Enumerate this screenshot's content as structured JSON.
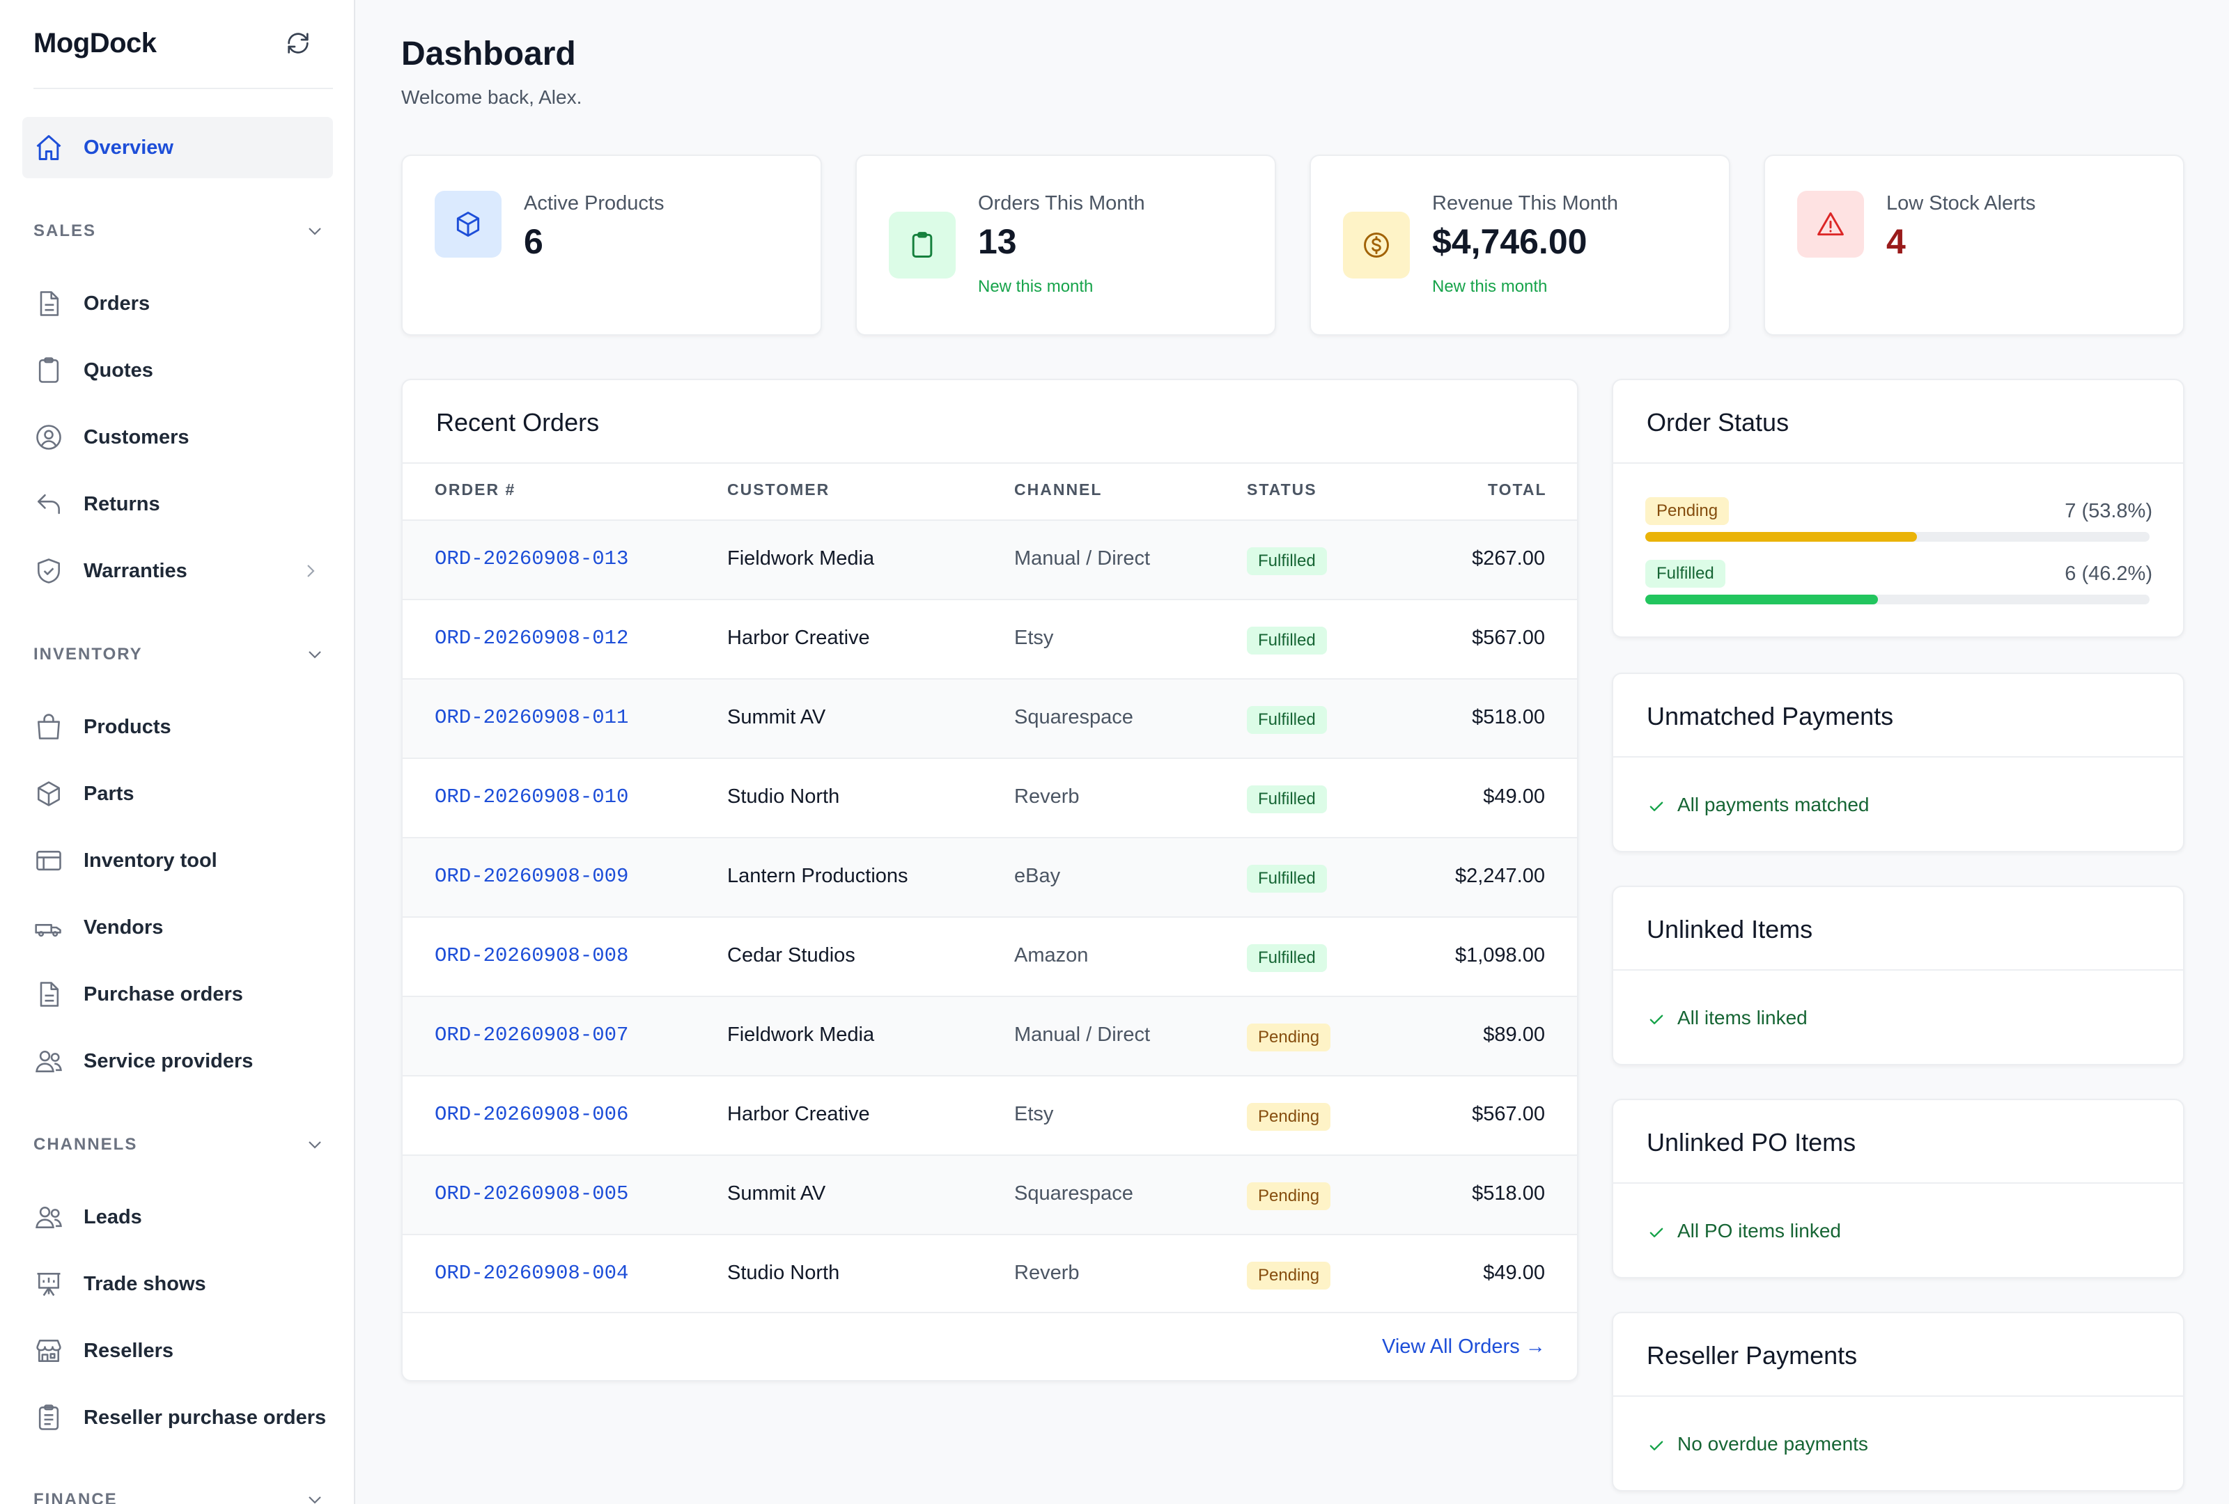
{
  "app": {
    "name": "MogDock"
  },
  "sidebar": {
    "overview": "Overview",
    "sections": {
      "sales": "SALES",
      "inventory": "INVENTORY",
      "channels": "CHANNELS",
      "finance": "FINANCE"
    },
    "sales_items": [
      "Orders",
      "Quotes",
      "Customers",
      "Returns",
      "Warranties"
    ],
    "inventory_items": [
      "Products",
      "Parts",
      "Inventory tool",
      "Vendors",
      "Purchase orders",
      "Service providers"
    ],
    "channels_items": [
      "Leads",
      "Trade shows",
      "Resellers",
      "Reseller purchase orders"
    ]
  },
  "header": {
    "title": "Dashboard",
    "subtitle": "Welcome back, Alex."
  },
  "stats": [
    {
      "label": "Active Products",
      "value": "6",
      "note": ""
    },
    {
      "label": "Orders This Month",
      "value": "13",
      "note": "New this month"
    },
    {
      "label": "Revenue This Month",
      "value": "$4,746.00",
      "note": "New this month"
    },
    {
      "label": "Low Stock Alerts",
      "value": "4",
      "note": ""
    }
  ],
  "recent_orders": {
    "title": "Recent Orders",
    "columns": [
      "ORDER #",
      "CUSTOMER",
      "CHANNEL",
      "STATUS",
      "TOTAL"
    ],
    "rows": [
      {
        "id": "ORD-20260908-013",
        "customer": "Fieldwork Media",
        "channel": "Manual / Direct",
        "status": "Fulfilled",
        "total": "$267.00"
      },
      {
        "id": "ORD-20260908-012",
        "customer": "Harbor Creative",
        "channel": "Etsy",
        "status": "Fulfilled",
        "total": "$567.00"
      },
      {
        "id": "ORD-20260908-011",
        "customer": "Summit AV",
        "channel": "Squarespace",
        "status": "Fulfilled",
        "total": "$518.00"
      },
      {
        "id": "ORD-20260908-010",
        "customer": "Studio North",
        "channel": "Reverb",
        "status": "Fulfilled",
        "total": "$49.00"
      },
      {
        "id": "ORD-20260908-009",
        "customer": "Lantern Productions",
        "channel": "eBay",
        "status": "Fulfilled",
        "total": "$2,247.00"
      },
      {
        "id": "ORD-20260908-008",
        "customer": "Cedar Studios",
        "channel": "Amazon",
        "status": "Fulfilled",
        "total": "$1,098.00"
      },
      {
        "id": "ORD-20260908-007",
        "customer": "Fieldwork Media",
        "channel": "Manual / Direct",
        "status": "Pending",
        "total": "$89.00"
      },
      {
        "id": "ORD-20260908-006",
        "customer": "Harbor Creative",
        "channel": "Etsy",
        "status": "Pending",
        "total": "$567.00"
      },
      {
        "id": "ORD-20260908-005",
        "customer": "Summit AV",
        "channel": "Squarespace",
        "status": "Pending",
        "total": "$518.00"
      },
      {
        "id": "ORD-20260908-004",
        "customer": "Studio North",
        "channel": "Reverb",
        "status": "Pending",
        "total": "$49.00"
      }
    ],
    "view_all": "View All Orders →"
  },
  "order_status": {
    "title": "Order Status",
    "items": [
      {
        "label": "Pending",
        "count": "7 (53.8%)",
        "fraction": 0.538,
        "color": "#eab308"
      },
      {
        "label": "Fulfilled",
        "count": "6 (46.2%)",
        "fraction": 0.462,
        "color": "#22c55e"
      }
    ]
  },
  "unmatched_payments": {
    "title": "Unmatched Payments",
    "message": "All payments matched"
  },
  "unlinked_items": {
    "title": "Unlinked Items",
    "message": "All items linked"
  },
  "unlinked_po_items": {
    "title": "Unlinked PO Items",
    "message": "All PO items linked"
  },
  "reseller_payments": {
    "title": "Reseller Payments",
    "message": "No overdue payments"
  },
  "colors": {
    "accent": "#1d4ed8",
    "success": "#16a34a",
    "danger": "#991b1b"
  }
}
